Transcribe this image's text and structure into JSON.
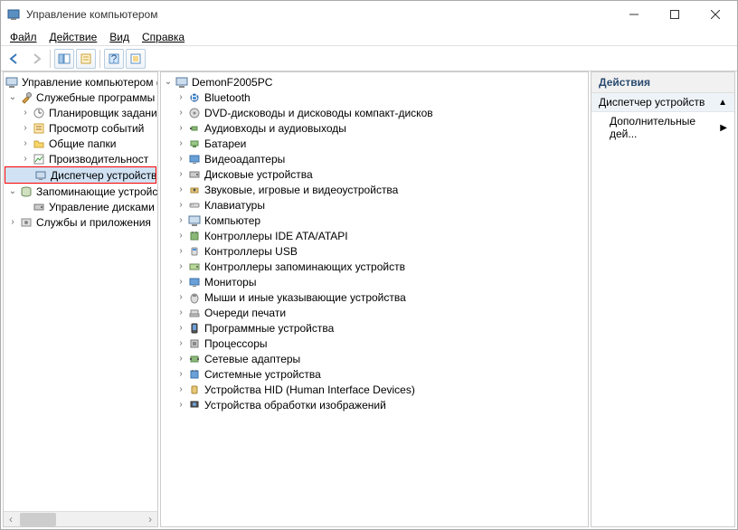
{
  "window": {
    "title": "Управление компьютером"
  },
  "menu": {
    "file": "Файл",
    "action": "Действие",
    "view": "Вид",
    "help": "Справка"
  },
  "leftTree": {
    "root": "Управление компьютером (л",
    "systemTools": "Служебные программы",
    "taskScheduler": "Планировщик заданий",
    "eventViewer": "Просмотр событий",
    "sharedFolders": "Общие папки",
    "performance": "Производительност",
    "deviceManager": "Диспетчер устройств",
    "storage": "Запоминающие устройс",
    "diskManagement": "Управление дисками",
    "services": "Службы и приложения"
  },
  "midTree": {
    "root": "DemonF2005PC",
    "items": [
      "Bluetooth",
      "DVD-дисководы и дисководы компакт-дисков",
      "Аудиовходы и аудиовыходы",
      "Батареи",
      "Видеоадаптеры",
      "Дисковые устройства",
      "Звуковые, игровые и видеоустройства",
      "Клавиатуры",
      "Компьютер",
      "Контроллеры IDE ATA/ATAPI",
      "Контроллеры USB",
      "Контроллеры запоминающих устройств",
      "Мониторы",
      "Мыши и иные указывающие устройства",
      "Очереди печати",
      "Программные устройства",
      "Процессоры",
      "Сетевые адаптеры",
      "Системные устройства",
      "Устройства HID (Human Interface Devices)",
      "Устройства обработки изображений"
    ]
  },
  "actions": {
    "header": "Действия",
    "subheader": "Диспетчер устройств",
    "more": "Дополнительные дей..."
  }
}
